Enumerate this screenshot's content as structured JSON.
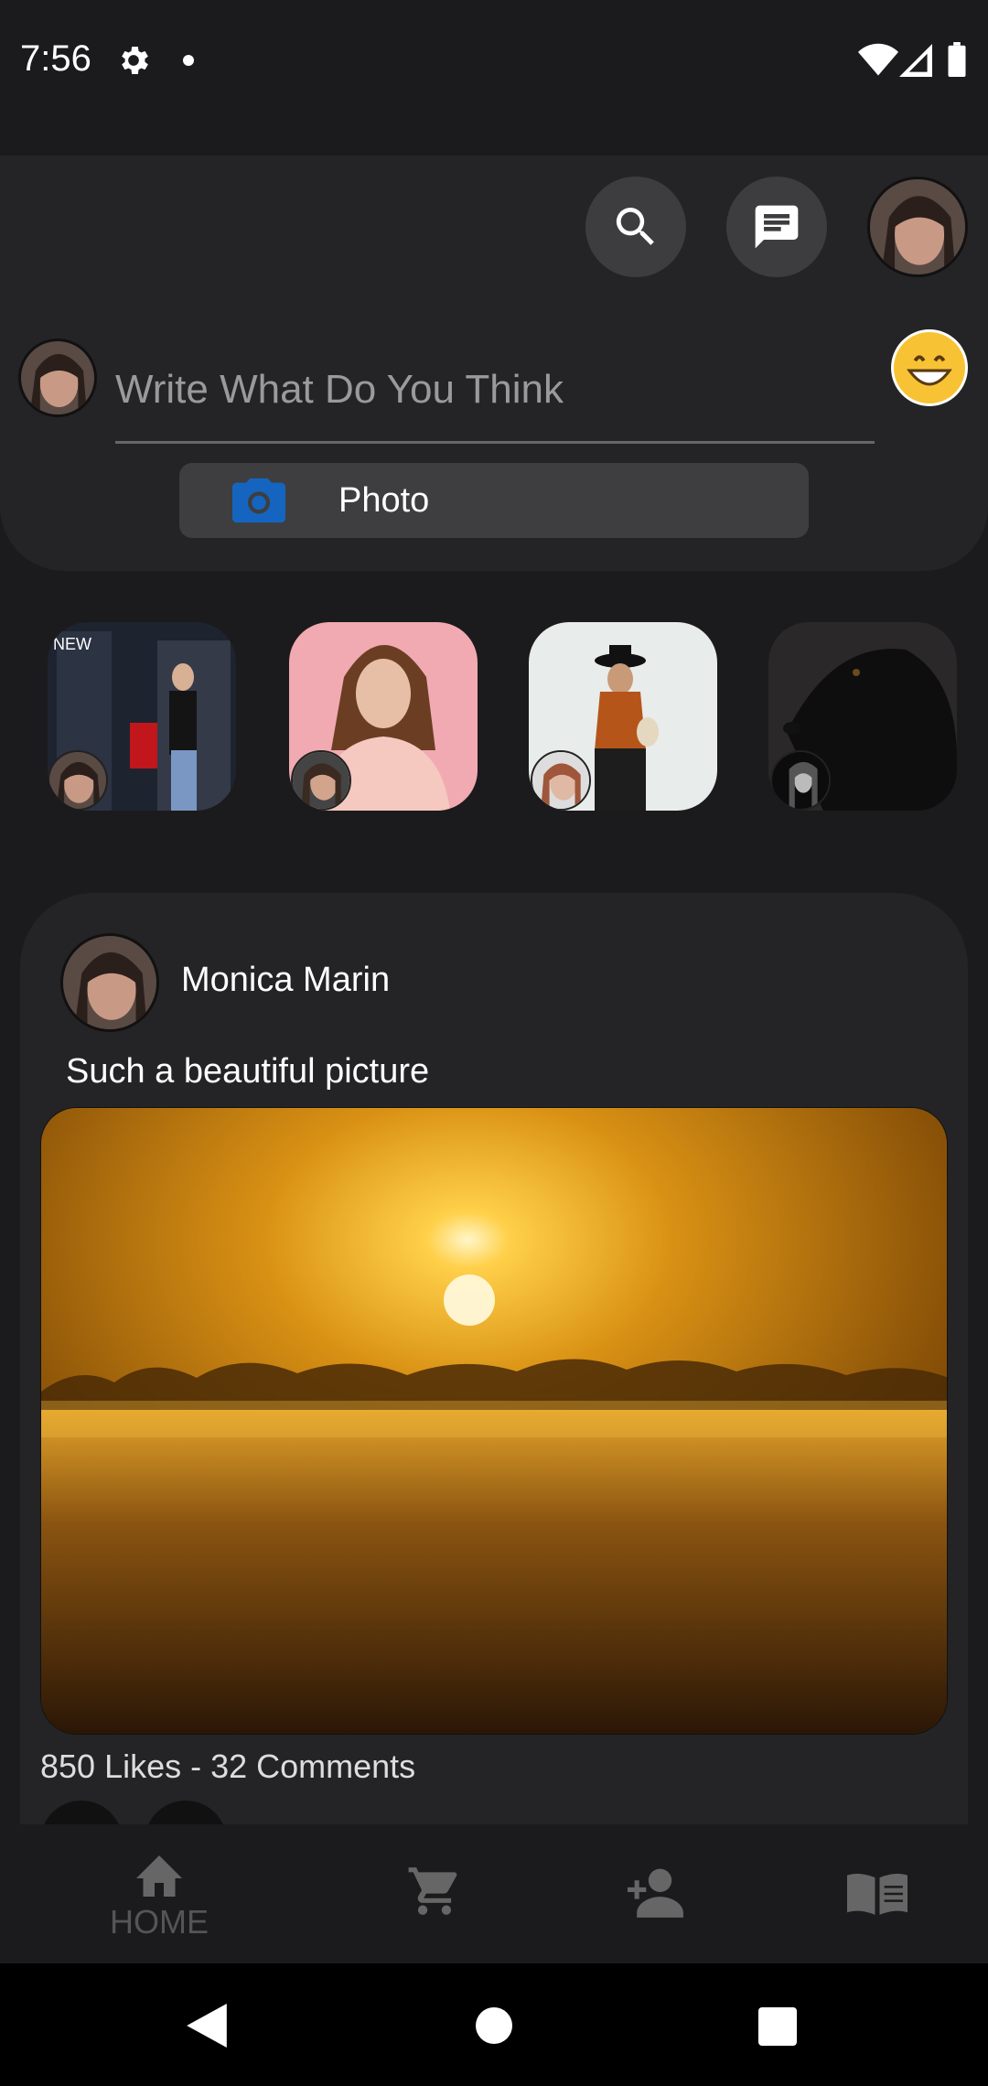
{
  "status_bar": {
    "time": "7:56"
  },
  "top_bar": {
    "search_icon": "search-icon",
    "messages_icon": "message-icon",
    "profile_avatar": "user-avatar"
  },
  "composer": {
    "placeholder": "Write What Do You Think",
    "photo_label": "Photo",
    "emoji_icon": "grinning-emoji-icon",
    "photo_icon": "camera-icon"
  },
  "stories": [
    {
      "name": "story-street-fashion",
      "bg": "#2b2f3a"
    },
    {
      "name": "story-pink-portrait",
      "bg": "#f1aab1"
    },
    {
      "name": "story-hijab-fashion",
      "bg": "#e8ecea"
    },
    {
      "name": "story-black-dog",
      "bg": "#2a2828"
    }
  ],
  "post": {
    "author": "Monica Marin",
    "text": "Such a beautiful picture",
    "stats": "850 Likes - 32 Comments"
  },
  "bottom_nav": {
    "home_label": "HOME",
    "items": [
      "home-icon",
      "cart-icon",
      "add-person-icon",
      "book-icon"
    ]
  },
  "colors": {
    "background": "#1b1b1d",
    "surface": "#242426",
    "button": "#3d3d40",
    "camera_blue": "#1565c0",
    "emoji_yellow": "#f7c335"
  }
}
